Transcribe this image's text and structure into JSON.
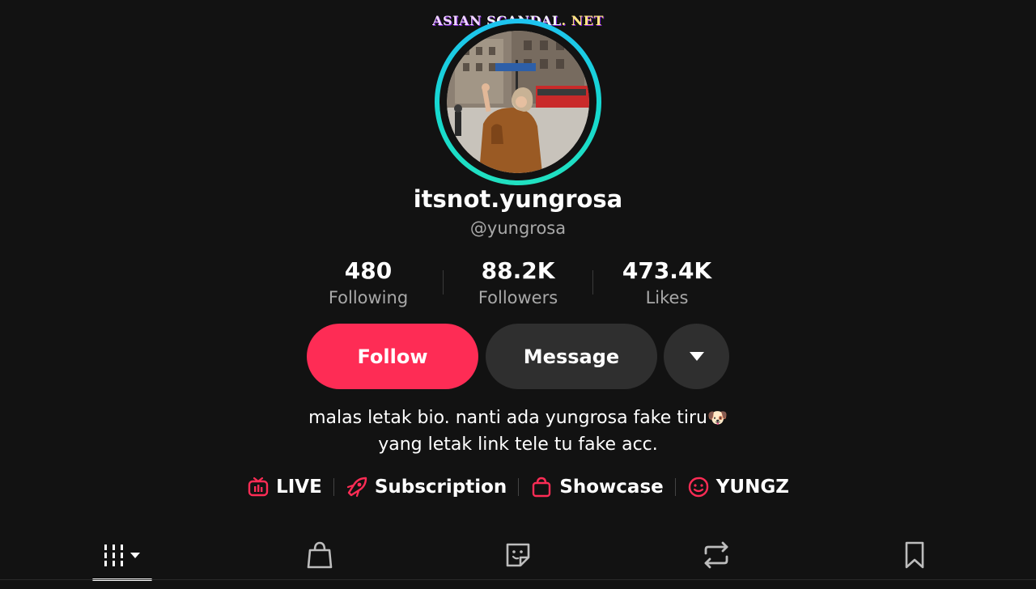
{
  "watermark": {
    "part1": "ASIAN",
    "part2": "SCANDAL",
    "part3": ". NET"
  },
  "profile": {
    "display_name": "itsnot.yungrosa",
    "handle": "@yungrosa"
  },
  "stats": [
    {
      "value": "480",
      "label": "Following"
    },
    {
      "value": "88.2K",
      "label": "Followers"
    },
    {
      "value": "473.4K",
      "label": "Likes"
    }
  ],
  "actions": {
    "follow_label": "Follow",
    "message_label": "Message",
    "more_icon": "caret-down-icon"
  },
  "bio": {
    "line1": "malas letak bio. nanti ada yungrosa fake tiru",
    "emoji": "🐶",
    "line2": "yang letak link tele tu fake acc."
  },
  "links": [
    {
      "icon": "live-tv-icon",
      "label": "LIVE"
    },
    {
      "icon": "subscription-icon",
      "label": "Subscription"
    },
    {
      "icon": "shopping-bag-icon",
      "label": "Showcase"
    },
    {
      "icon": "sticker-smile-icon",
      "label": "YUNGZ"
    }
  ],
  "tabs": [
    {
      "icon": "videos-grid-icon",
      "selected": true
    },
    {
      "icon": "shop-bag-icon",
      "selected": false
    },
    {
      "icon": "sticker-icon",
      "selected": false
    },
    {
      "icon": "repost-icon",
      "selected": false
    },
    {
      "icon": "bookmark-icon",
      "selected": false
    }
  ],
  "colors": {
    "background": "#121212",
    "accent": "#fe2c55",
    "button_secondary": "#2f2f2f",
    "muted_text": "#a8a8a8",
    "ring_start": "#1ec3f0",
    "ring_end": "#21e0c0"
  }
}
